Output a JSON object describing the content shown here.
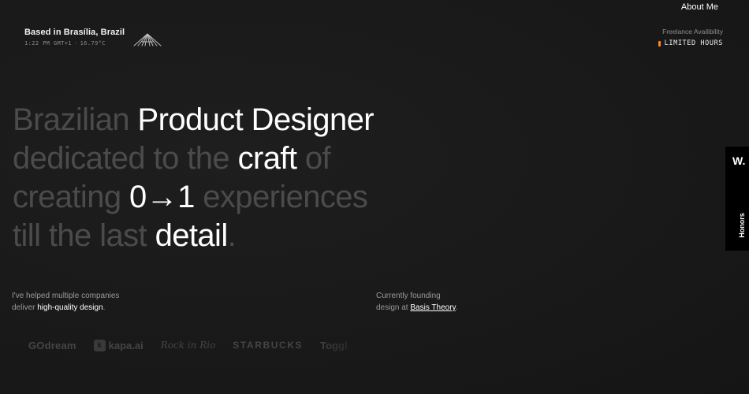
{
  "nav": {
    "about_label": "About Me"
  },
  "location": {
    "title": "Based in Brasília, Brazil",
    "time": "1:22 PM GMT+1",
    "temperature": "16.79°C",
    "landmark_icon": "cathedral-icon"
  },
  "availability": {
    "label": "Freelance Availibility",
    "status": "LIMITED HOURS",
    "status_color": "#ff8a1e"
  },
  "headline": {
    "line1": {
      "dim": "Brazilian ",
      "bright": "Product Designer"
    },
    "line2": {
      "dim1": "dedicated to the ",
      "bright": "craft",
      "dim2": " of"
    },
    "line3": {
      "dim1": "creating ",
      "bright": "0→1",
      "dim2": " experiences"
    },
    "line4": {
      "dim1": "till the last ",
      "bright": "detail",
      "dim2": "."
    }
  },
  "description_left": {
    "line1": "I've helped multiple companies",
    "prefix": "deliver ",
    "emphasis": "high-quality design",
    "suffix": "."
  },
  "description_right": {
    "line1": "Currently founding",
    "prefix": "design at ",
    "link": "Basis Theory",
    "suffix": "."
  },
  "clients": [
    {
      "name": "GOdream",
      "icon": "goodream-logo"
    },
    {
      "mark": "k",
      "name": "kapa.ai",
      "icon": "kapa-logo"
    },
    {
      "name": "Rock in Rio",
      "icon": "rock-in-rio-logo"
    },
    {
      "name": "STARBUCKS",
      "icon": "starbucks-logo"
    },
    {
      "name": "Toggl",
      "icon": "toggl-logo"
    }
  ],
  "side_tab": {
    "logo": "W.",
    "label": "Honors"
  },
  "colors": {
    "background": "#1a1a1a",
    "text_bright": "#ffffff",
    "text_dim": "#4b4b4b",
    "accent": "#ff8a1e"
  }
}
